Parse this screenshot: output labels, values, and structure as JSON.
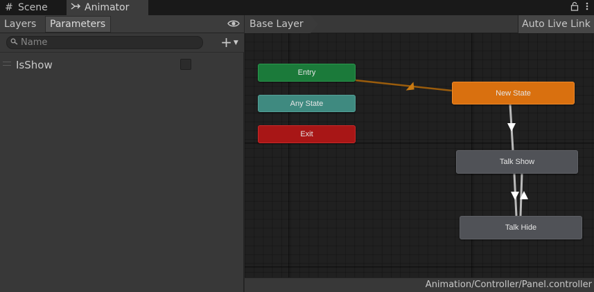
{
  "window_tabs": [
    {
      "label": "Scene",
      "icon": "grid-icon"
    },
    {
      "label": "Animator",
      "icon": "animator-icon"
    }
  ],
  "parameters_panel": {
    "tabs": [
      {
        "label": "Layers",
        "selected": false
      },
      {
        "label": "Parameters",
        "selected": true
      }
    ],
    "search": {
      "placeholder": "Name",
      "value": ""
    },
    "add_icon": "plus-icon",
    "parameters": [
      {
        "name": "IsShow",
        "type": "bool",
        "checked": false
      }
    ]
  },
  "graph": {
    "breadcrumb": "Base Layer",
    "auto_live_link_label": "Auto Live Link",
    "nodes": {
      "entry": "Entry",
      "any_state": "Any State",
      "exit": "Exit",
      "new_state": "New State",
      "talk_show": "Talk Show",
      "talk_hide": "Talk Hide"
    },
    "colors": {
      "entry": "#1b7a3a",
      "any_state": "#3f8a80",
      "exit": "#a81616",
      "default_state": "#d9700f",
      "state": "#505257",
      "default_transition": "#c97a12"
    },
    "status_path": "Animation/Controller/Panel.controller"
  }
}
